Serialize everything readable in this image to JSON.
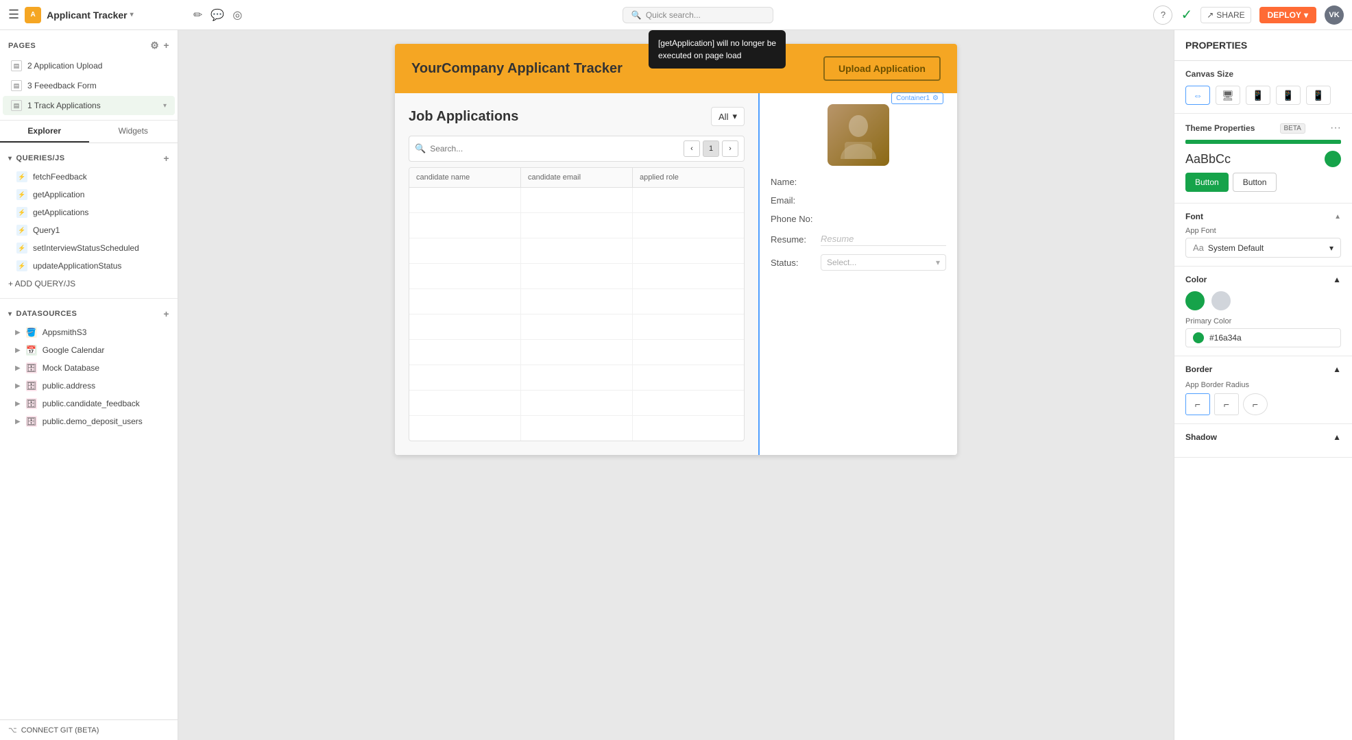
{
  "topbar": {
    "app_title": "Applicant Tracker",
    "edit_icon": "✏",
    "comment_icon": "💬",
    "eye_icon": "👁",
    "search_placeholder": "Quick search...",
    "help_label": "?",
    "share_label": "SHARE",
    "deploy_label": "DEPLOY",
    "user_initials": "VK"
  },
  "sidebar": {
    "pages_label": "PAGES",
    "pages": [
      {
        "id": "2",
        "label": "2 Application Upload"
      },
      {
        "id": "3",
        "label": "3 Feeedback Form"
      },
      {
        "id": "1",
        "label": "1 Track Applications"
      }
    ],
    "tabs": [
      "Explorer",
      "Widgets"
    ],
    "queries_label": "QUERIES/JS",
    "queries": [
      {
        "label": "fetchFeedback"
      },
      {
        "label": "getApplication"
      },
      {
        "label": "getApplications"
      },
      {
        "label": "Query1"
      },
      {
        "label": "setInterviewStatusScheduled"
      },
      {
        "label": "updateApplicationStatus"
      }
    ],
    "add_query_label": "+ ADD QUERY/JS",
    "datasources_label": "DATASOURCES",
    "datasources": [
      {
        "label": "AppsmithS3",
        "icon": "🪣"
      },
      {
        "label": "Google Calendar",
        "icon": "📅"
      },
      {
        "label": "Mock Database",
        "icon": "🗄"
      },
      {
        "label": "public.address",
        "icon": "🗄"
      },
      {
        "label": "public.candidate_feedback",
        "icon": "🗄"
      },
      {
        "label": "public.demo_deposit_users",
        "icon": "🗄"
      }
    ],
    "connect_git_label": "CONNECT GIT (BETA)"
  },
  "tooltip": {
    "text_line1": "[getApplication] will no longer be",
    "text_line2": "executed on page load"
  },
  "canvas": {
    "app_header_title": "YourCompany Applicant Tracker",
    "upload_button_label": "Upload Application",
    "table_title": "Job Applications",
    "filter_label": "All",
    "search_placeholder": "Search...",
    "pagination_current": "1",
    "table_columns": [
      "candidate name",
      "candidate email",
      "applied role"
    ],
    "table_rows": 10,
    "container_label": "Container1",
    "detail": {
      "name_label": "Name:",
      "email_label": "Email:",
      "phone_label": "Phone No:",
      "resume_label": "Resume:",
      "resume_placeholder": "Resume",
      "status_label": "Status:",
      "status_placeholder": "Select..."
    }
  },
  "properties": {
    "header": "PROPERTIES",
    "canvas_size_label": "Canvas Size",
    "theme_label": "Theme Properties",
    "beta_label": "BETA",
    "green_font_preview": "AaBbCc",
    "button_filled_label": "Button",
    "button_outline_label": "Button",
    "font_section_label": "Font",
    "app_font_label": "App Font",
    "font_value": "System Default",
    "color_section_label": "Color",
    "primary_color_label": "Primary Color",
    "primary_color_hex": "#16a34a",
    "border_section_label": "Border",
    "border_radius_label": "App Border Radius",
    "shadow_section_label": "Shadow"
  }
}
